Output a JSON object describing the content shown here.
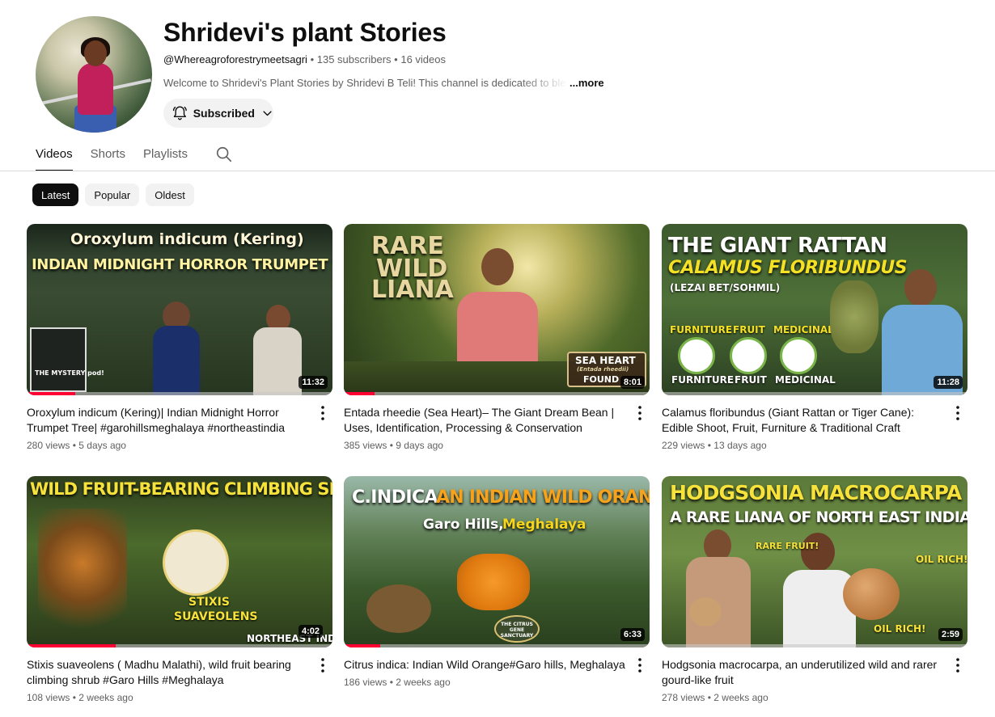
{
  "channel": {
    "title": "Shridevi's plant Stories",
    "handle": "@Whereagroforestrymeetsagri",
    "subscribers": "135 subscribers",
    "videos": "16 videos",
    "separator": "•",
    "description": "Welcome to Shridevi's Plant Stories by Shridevi B Teli! This channel is dedicated to blending",
    "more_label": "...more",
    "subscribe_label": "Subscribed"
  },
  "tabs": [
    {
      "label": "Videos",
      "active": true
    },
    {
      "label": "Shorts",
      "active": false
    },
    {
      "label": "Playlists",
      "active": false
    }
  ],
  "chips": [
    {
      "label": "Latest",
      "active": true
    },
    {
      "label": "Popular",
      "active": false
    },
    {
      "label": "Oldest",
      "active": false
    }
  ],
  "videos": [
    {
      "title": "Oroxylum indicum (Kering)| Indian Midnight Horror Trumpet Tree| #garohillsmeghalaya #northeastindia",
      "views": "280 views",
      "age": "5 days ago",
      "duration": "11:32",
      "progress": 0.16,
      "thumb_text": [
        "Oroxylum indicum (Kering)",
        "INDIAN MIDNIGHT HORROR TRUMPET TREE!",
        "THE MYSTERY pod!"
      ]
    },
    {
      "title": "Entada rheedie (Sea Heart)– The Giant Dream Bean | Uses, Identification, Processing & Conservation",
      "views": "385 views",
      "age": "9 days ago",
      "duration": "8:01",
      "progress": 0.1,
      "thumb_text": [
        "RARE",
        "WILD",
        "LIANA",
        "SEA HEART",
        "(Entada rheedii)",
        "FOUND"
      ]
    },
    {
      "title": "Calamus floribundus (Giant Rattan or Tiger Cane): Edible Shoot, Fruit, Furniture & Traditional Craft",
      "views": "229 views",
      "age": "13 days ago",
      "duration": "11:28",
      "progress": 0.0,
      "thumb_text": [
        "THE GIANT RATTAN",
        "CALAMUS FLORIBUNDUS",
        "(LEZAI BET/SOHMIL)",
        "FURNITURE",
        "FRUIT",
        "MEDICINAL",
        "FURNITURE",
        "FRUIT",
        "MEDICINAL"
      ]
    },
    {
      "title": "Stixis suaveolens ( Madhu Malathi), wild fruit bearing climbing shrub #Garo Hills #Meghalaya",
      "views": "108 views",
      "age": "2 weeks ago",
      "duration": "4:02",
      "progress": 0.29,
      "thumb_text": [
        "WILD FRUIT-BEARING CLIMBING SHRUB",
        "STIXIS",
        "SUAVEOLENS",
        "NORTHEAST INDIA"
      ]
    },
    {
      "title": "Citrus indica: Indian Wild Orange#Garo hills, Meghalaya",
      "views": "186 views",
      "age": "2 weeks ago",
      "duration": "6:33",
      "progress": 0.12,
      "thumb_text": [
        "C.INDICA:",
        "AN INDIAN WILD ORANGE",
        "Garo Hills,",
        "Meghalaya",
        "THE CITRUS GENE SANCTUARY"
      ]
    },
    {
      "title": "Hodgsonia macrocarpa, an underutilized wild and rarer gourd-like fruit",
      "views": "278 views",
      "age": "2 weeks ago",
      "duration": "2:59",
      "progress": 0.0,
      "thumb_text": [
        "HODGSONIA MACROCARPA",
        "A RARE LIANA OF NORTH EAST INDIA",
        "RARE FRUIT!",
        "OIL RICH!",
        "OIL RICH!"
      ]
    }
  ]
}
